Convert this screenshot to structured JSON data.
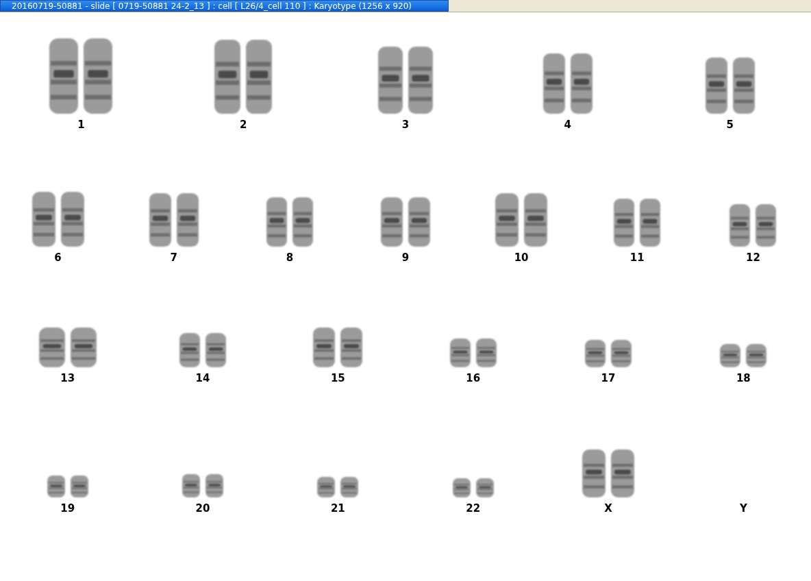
{
  "window": {
    "title": "20160719-50881 - slide [ 0719-50881 24-2_13 ] : cell [ L26/4_cell 110 ] : Karyotype  (1256 x 920)"
  },
  "rows": [
    {
      "items": [
        {
          "label": "1",
          "shown": true
        },
        {
          "label": "2",
          "shown": true
        },
        {
          "label": "3",
          "shown": true
        },
        {
          "label": "4",
          "shown": true
        },
        {
          "label": "5",
          "shown": true
        }
      ]
    },
    {
      "items": [
        {
          "label": "6",
          "shown": true
        },
        {
          "label": "7",
          "shown": true
        },
        {
          "label": "8",
          "shown": true
        },
        {
          "label": "9",
          "shown": true
        },
        {
          "label": "10",
          "shown": true
        },
        {
          "label": "11",
          "shown": true
        },
        {
          "label": "12",
          "shown": true
        }
      ]
    },
    {
      "items": [
        {
          "label": "13",
          "shown": true
        },
        {
          "label": "14",
          "shown": true
        },
        {
          "label": "15",
          "shown": true
        },
        {
          "label": "16",
          "shown": true
        },
        {
          "label": "17",
          "shown": true
        },
        {
          "label": "18",
          "shown": true
        }
      ]
    },
    {
      "items": [
        {
          "label": "19",
          "shown": true
        },
        {
          "label": "20",
          "shown": true
        },
        {
          "label": "21",
          "shown": true
        },
        {
          "label": "22",
          "shown": true
        },
        {
          "label": "X",
          "shown": true
        },
        {
          "label": "Y",
          "shown": false
        }
      ]
    }
  ]
}
